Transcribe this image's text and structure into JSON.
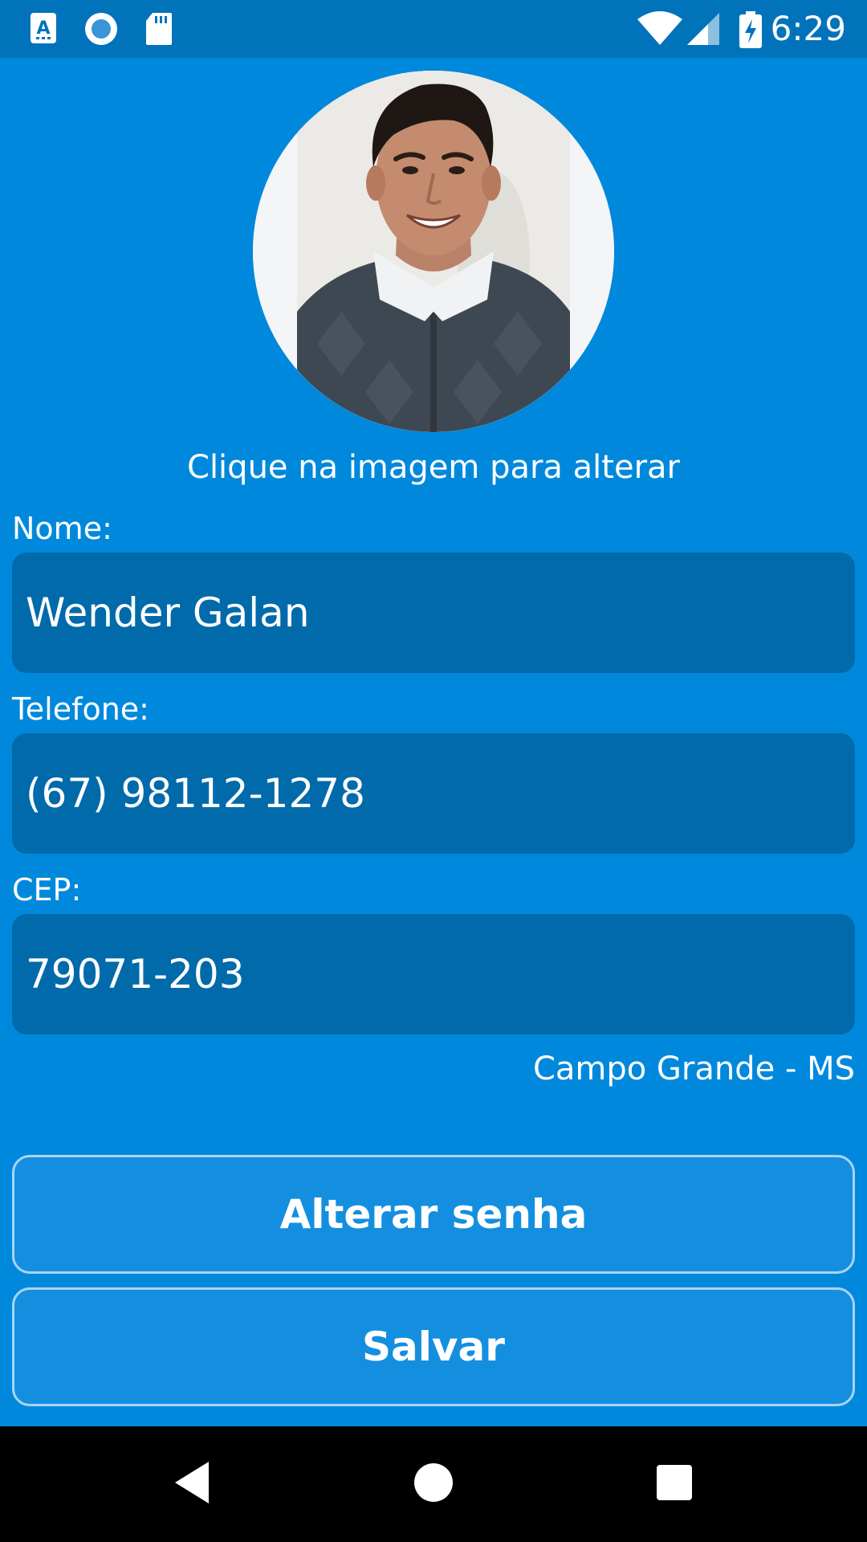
{
  "status_bar": {
    "time": "6:29",
    "left_icons": [
      "app-a-icon",
      "circle-notification-icon",
      "sd-card-icon"
    ],
    "right_icons": [
      "wifi-icon",
      "cell-signal-icon",
      "battery-charging-icon"
    ]
  },
  "profile": {
    "avatar_hint": "Clique na imagem para alterar"
  },
  "form": {
    "name_label": "Nome:",
    "name_value": "Wender Galan",
    "phone_label": "Telefone:",
    "phone_value": "(67) 98112-1278",
    "cep_label": "CEP:",
    "cep_value": "79071-203",
    "city": "Campo Grande - MS"
  },
  "buttons": {
    "change_password": "Alterar senha",
    "save": "Salvar"
  },
  "nav_bar": {
    "icons": [
      "back-icon",
      "home-icon",
      "recents-icon"
    ]
  },
  "colors": {
    "background": "#0089dc",
    "status_bar": "#0073bb",
    "input_background": "#006aab",
    "button_background": "#148fe0",
    "button_border": "#a9d4f2"
  }
}
